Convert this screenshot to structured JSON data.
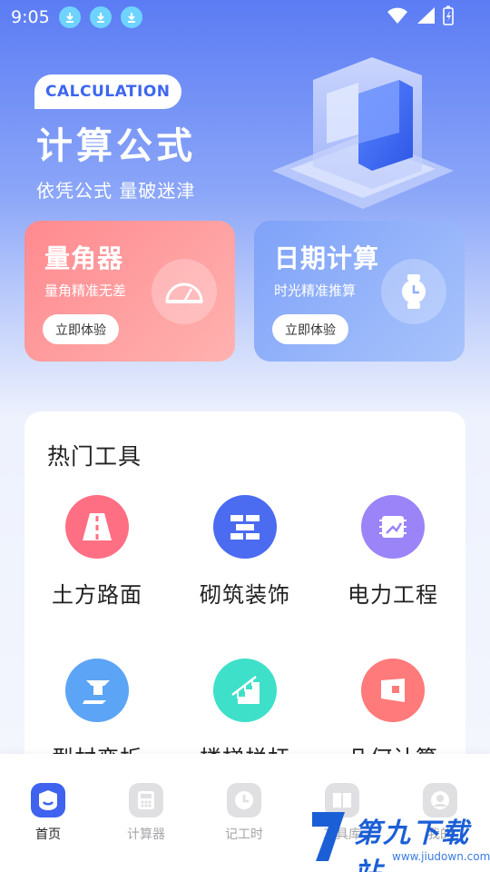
{
  "status_bar": {
    "time": "9:05"
  },
  "hero": {
    "badge": "CALCULATION",
    "title": "计算公式",
    "subtitle": "依凭公式  量破迷津"
  },
  "cards": [
    {
      "title": "量角器",
      "subtitle": "量角精准无差",
      "button": "立即体验",
      "icon": "protractor-icon",
      "color": "#ff8a8f"
    },
    {
      "title": "日期计算",
      "subtitle": "时光精准推算",
      "button": "立即体验",
      "icon": "watch-icon",
      "color": "#7fa2f9"
    }
  ],
  "tools": {
    "title": "热门工具",
    "items": [
      {
        "label": "土方路面",
        "icon": "road-icon",
        "color": "#ff6f83"
      },
      {
        "label": "砌筑装饰",
        "icon": "brick-icon",
        "color": "#4b6bf0"
      },
      {
        "label": "电力工程",
        "icon": "circuit-icon",
        "color": "#9b84f7"
      },
      {
        "label": "型材变折",
        "icon": "profile-icon",
        "color": "#5ca4f5"
      },
      {
        "label": "楼梯栏杆",
        "icon": "stairs-icon",
        "color": "#3fe0c9"
      },
      {
        "label": "几何计算",
        "icon": "geometry-icon",
        "color": "#ff7a7a"
      }
    ]
  },
  "nav": [
    {
      "label": "首页",
      "icon": "home-icon",
      "active": true
    },
    {
      "label": "计算器",
      "icon": "calculator-icon",
      "active": false
    },
    {
      "label": "记工时",
      "icon": "clock-icon",
      "active": false
    },
    {
      "label": "工具库",
      "icon": "book-icon",
      "active": false
    },
    {
      "label": "我的",
      "icon": "user-icon",
      "active": false
    }
  ],
  "watermark": {
    "text": "第九下载站",
    "url": "www.jiudown.com"
  }
}
